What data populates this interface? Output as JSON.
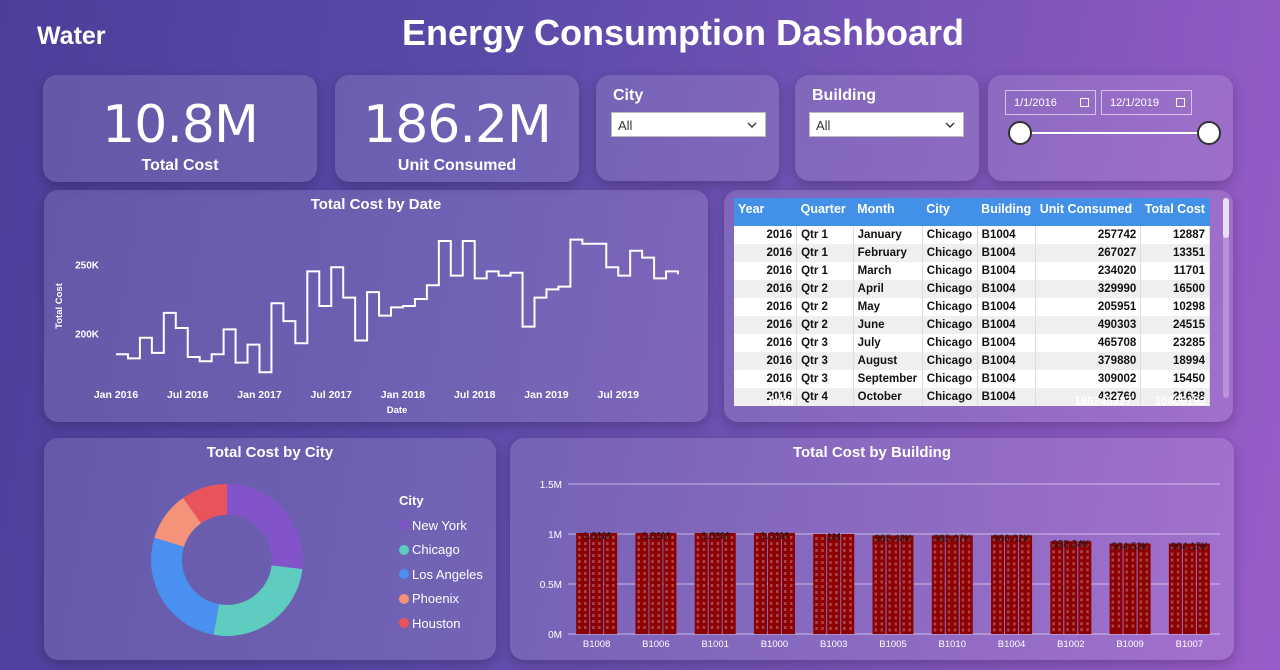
{
  "page": {
    "label": "Water",
    "title": "Energy Consumption Dashboard"
  },
  "kpis": [
    {
      "value": "10.8M",
      "label": "Total Cost"
    },
    {
      "value": "186.2M",
      "label": "Unit Consumed"
    }
  ],
  "slicers": {
    "city": {
      "title": "City",
      "value": "All"
    },
    "building": {
      "title": "Building",
      "value": "All"
    },
    "date": {
      "start": "1/1/2016",
      "end": "12/1/2019"
    }
  },
  "colors": {
    "accent_blue": "#4290e8",
    "bar": "#8b0000",
    "new_york": "#8353c9",
    "chicago": "#5ecdc0",
    "los_angeles": "#4a90f0",
    "phoenix": "#f4937a",
    "houston": "#e8545a"
  },
  "table": {
    "columns": [
      "Year",
      "Quarter",
      "Month",
      "City",
      "Building",
      "Unit Consumed",
      "Total Cost"
    ],
    "rows": [
      [
        "2016",
        "Qtr 1",
        "January",
        "Chicago",
        "B1004",
        "257742",
        "12887"
      ],
      [
        "2016",
        "Qtr 1",
        "February",
        "Chicago",
        "B1004",
        "267027",
        "13351"
      ],
      [
        "2016",
        "Qtr 1",
        "March",
        "Chicago",
        "B1004",
        "234020",
        "11701"
      ],
      [
        "2016",
        "Qtr 2",
        "April",
        "Chicago",
        "B1004",
        "329990",
        "16500"
      ],
      [
        "2016",
        "Qtr 2",
        "May",
        "Chicago",
        "B1004",
        "205951",
        "10298"
      ],
      [
        "2016",
        "Qtr 2",
        "June",
        "Chicago",
        "B1004",
        "490303",
        "24515"
      ],
      [
        "2016",
        "Qtr 3",
        "July",
        "Chicago",
        "B1004",
        "465708",
        "23285"
      ],
      [
        "2016",
        "Qtr 3",
        "August",
        "Chicago",
        "B1004",
        "379880",
        "18994"
      ],
      [
        "2016",
        "Qtr 3",
        "September",
        "Chicago",
        "B1004",
        "309002",
        "15450"
      ],
      [
        "2016",
        "Qtr 4",
        "October",
        "Chicago",
        "B1004",
        "432760",
        "21638"
      ]
    ],
    "total": {
      "label": "Total",
      "unit_consumed": "186245327",
      "total_cost": "10806192"
    }
  },
  "chart_data": [
    {
      "type": "line",
      "title": "Total Cost by Date",
      "xlabel": "Date",
      "ylabel": "Total Cost",
      "x_tick_labels": [
        "Jan 2016",
        "Jul 2016",
        "Jan 2017",
        "Jul 2017",
        "Jan 2018",
        "Jul 2018",
        "Jan 2019",
        "Jul 2019"
      ],
      "y_tick_labels": [
        "250K",
        "200K"
      ],
      "x": [
        "2016-01",
        "2016-02",
        "2016-03",
        "2016-04",
        "2016-05",
        "2016-06",
        "2016-07",
        "2016-08",
        "2016-09",
        "2016-10",
        "2016-11",
        "2016-12",
        "2017-01",
        "2017-02",
        "2017-03",
        "2017-04",
        "2017-05",
        "2017-06",
        "2017-07",
        "2017-08",
        "2017-09",
        "2017-10",
        "2017-11",
        "2017-12",
        "2018-01",
        "2018-02",
        "2018-03",
        "2018-04",
        "2018-05",
        "2018-06",
        "2018-07",
        "2018-08",
        "2018-09",
        "2018-10",
        "2018-11",
        "2018-12",
        "2019-01",
        "2019-02",
        "2019-03",
        "2019-04",
        "2019-05",
        "2019-06",
        "2019-07",
        "2019-08",
        "2019-09",
        "2019-10",
        "2019-11",
        "2019-12"
      ],
      "y": [
        185000,
        182000,
        197000,
        186000,
        215000,
        204000,
        183000,
        180000,
        185000,
        203000,
        179000,
        192000,
        172000,
        222000,
        209000,
        193000,
        245000,
        220000,
        248000,
        226000,
        195000,
        230000,
        213000,
        219000,
        220000,
        225000,
        235000,
        267000,
        242000,
        267000,
        240000,
        245000,
        242000,
        244000,
        205000,
        226000,
        232000,
        234000,
        268000,
        265000,
        265000,
        248000,
        242000,
        260000,
        255000,
        240000,
        245000,
        243000
      ],
      "ylim": [
        170000,
        275000
      ]
    },
    {
      "type": "pie",
      "title": "Total Cost by City",
      "legend_title": "City",
      "categories": [
        "New York",
        "Chicago",
        "Los Angeles",
        "Phoenix",
        "Houston"
      ],
      "values": [
        2.7,
        2.6,
        2.7,
        1.05,
        0.98
      ]
    },
    {
      "type": "bar",
      "title": "Total Cost by Building",
      "categories": [
        "B1008",
        "B1006",
        "B1001",
        "B1000",
        "B1003",
        "B1005",
        "B1010",
        "B1004",
        "B1002",
        "B1009",
        "B1007"
      ],
      "values": [
        1010000,
        1010000,
        1010000,
        1010000,
        1000000,
        985480,
        985070,
        986020,
        928240,
        904530,
        904150
      ],
      "data_labels": [
        "1.01M",
        "1.01M",
        "1.01M",
        "1.01M",
        "1M",
        "985.48K",
        "985.07K",
        "986.02K",
        "928.24K",
        "904.53K",
        "904.15K"
      ],
      "y_tick_labels": [
        "1.5M",
        "1M",
        "0.5M",
        "0M"
      ],
      "ylim": [
        0,
        1500000
      ]
    }
  ]
}
